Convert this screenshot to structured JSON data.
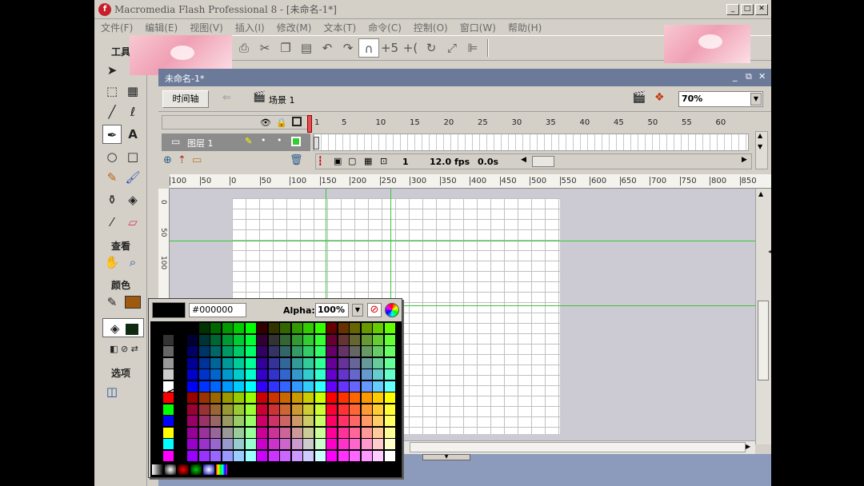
{
  "window": {
    "title": "Macromedia Flash Professional 8 - [未命名-1*]",
    "logo": "f"
  },
  "menu": [
    "文件(F)",
    "编辑(E)",
    "视图(V)",
    "插入(I)",
    "修改(M)",
    "文本(T)",
    "命令(C)",
    "控制(O)",
    "窗口(W)",
    "帮助(H)"
  ],
  "tools_panel": {
    "header_tools": "工具",
    "header_view": "查看",
    "header_colors": "颜色",
    "header_options": "选项"
  },
  "document": {
    "tab_name": "未命名-1*",
    "timeline_button": "时间轴",
    "scene_label": "场景 1",
    "zoom_value": "70%"
  },
  "timeline": {
    "frame_numbers": [
      "1",
      "5",
      "10",
      "15",
      "20",
      "25",
      "30",
      "35",
      "40",
      "45",
      "50",
      "55",
      "60"
    ],
    "layer_name": "图层 1",
    "current_frame": "1",
    "frame_rate": "12.0 fps",
    "elapsed_time": "0.0s"
  },
  "ruler_h": [
    "100",
    "50",
    "0",
    "50",
    "100",
    "150",
    "200",
    "250",
    "300",
    "350",
    "400",
    "450",
    "500",
    "550",
    "600",
    "650",
    "700",
    "750",
    "800",
    "850"
  ],
  "ruler_v": [
    "0",
    "50",
    "100"
  ],
  "color_popup": {
    "hex_value": "#000000",
    "alpha_label": "Alpha:",
    "alpha_value": "100%",
    "preview_color": "#000000"
  },
  "colors": {
    "guide": "#38c838",
    "doc_tab": "#6b7a99",
    "stage": "#ffffff",
    "workspace": "#cccad3"
  }
}
